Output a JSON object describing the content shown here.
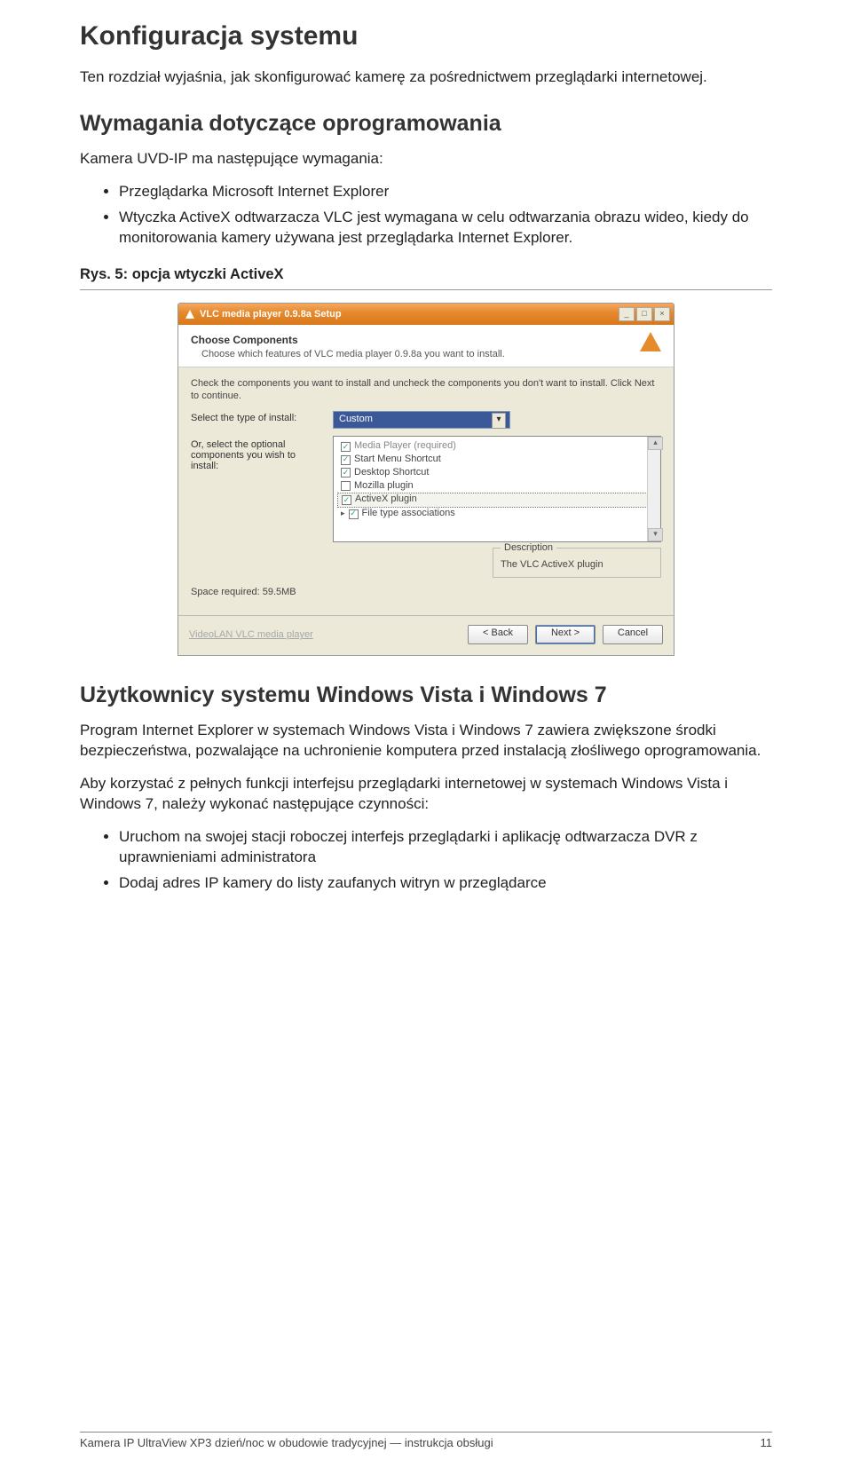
{
  "doc": {
    "h1": "Konfiguracja systemu",
    "intro": "Ten rozdział wyjaśnia, jak skonfigurować kamerę za pośrednictwem przeglądarki internetowej.",
    "h2a": "Wymagania dotyczące oprogramowania",
    "req_intro": "Kamera UVD-IP ma następujące wymagania:",
    "req_items": [
      "Przeglądarka Microsoft Internet Explorer",
      "Wtyczka ActiveX odtwarzacza VLC jest wymagana w celu odtwarzania obrazu wideo, kiedy do monitorowania kamery używana jest przeglądarka Internet Explorer."
    ],
    "caption": "Rys. 5: opcja wtyczki ActiveX",
    "h2b": "Użytkownicy systemu Windows Vista i Windows 7",
    "vista_p1": "Program Internet Explorer w systemach Windows Vista i Windows 7 zawiera zwiększone środki bezpieczeństwa, pozwalające na uchronienie komputera przed instalacją złośliwego oprogramowania.",
    "vista_p2": "Aby korzystać z pełnych funkcji interfejsu przeglądarki internetowej w systemach Windows Vista i Windows 7, należy wykonać następujące czynności:",
    "vista_items": [
      "Uruchom na swojej stacji roboczej interfejs przeglądarki i aplikację odtwarzacza DVR z uprawnieniami administratora",
      "Dodaj adres IP kamery do listy zaufanych witryn w przeglądarce"
    ]
  },
  "installer": {
    "title": "VLC media player 0.9.8a Setup",
    "header_title": "Choose Components",
    "header_sub": "Choose which features of VLC media player 0.9.8a you want to install.",
    "instruction": "Check the components you want to install and uncheck the components you don't want to install. Click Next to continue.",
    "type_label": "Select the type of install:",
    "type_value": "Custom",
    "opt_label": "Or, select the optional components you wish to install:",
    "list": [
      {
        "label": "Media Player (required)",
        "checked": true,
        "grey": true,
        "indent": false
      },
      {
        "label": "Start Menu Shortcut",
        "checked": true,
        "grey": false,
        "indent": false
      },
      {
        "label": "Desktop Shortcut",
        "checked": true,
        "grey": false,
        "indent": false
      },
      {
        "label": "Mozilla plugin",
        "checked": false,
        "grey": false,
        "indent": false
      },
      {
        "label": "ActiveX plugin",
        "checked": true,
        "grey": false,
        "indent": false,
        "highlight": true
      },
      {
        "label": "File type associations",
        "checked": true,
        "grey": false,
        "indent": false,
        "expandable": true
      }
    ],
    "desc_legend": "Description",
    "desc_text": "The VLC ActiveX plugin",
    "space": "Space required: 59.5MB",
    "brand": "VideoLAN VLC media player",
    "btn_back": "< Back",
    "btn_next": "Next >",
    "btn_cancel": "Cancel"
  },
  "footer": {
    "left": "Kamera IP UltraView XP3 dzień/noc w obudowie tradycyjnej — instrukcja obsługi",
    "right": "11"
  }
}
